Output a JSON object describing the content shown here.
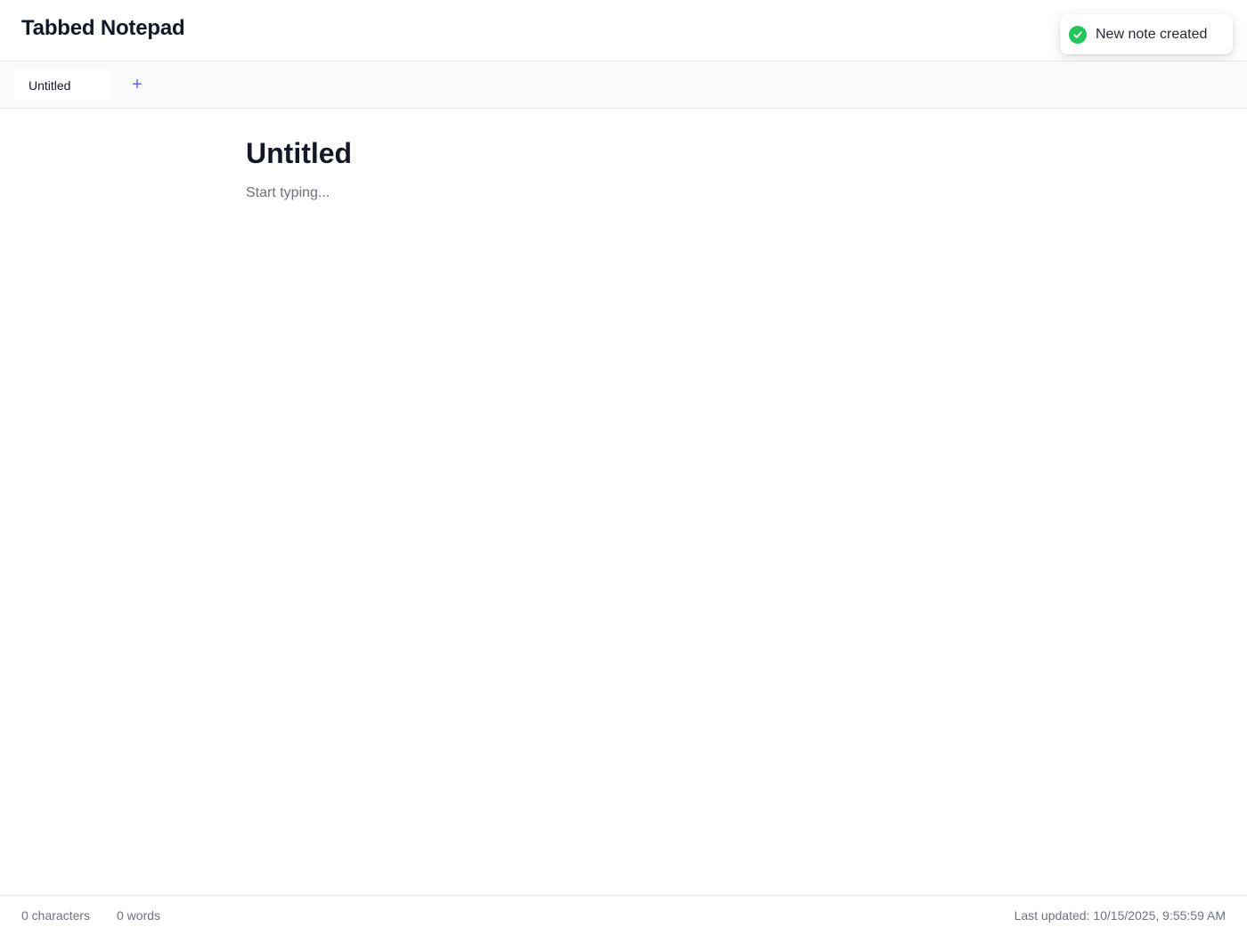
{
  "header": {
    "title": "Tabbed Notepad"
  },
  "toast": {
    "message": "New note created",
    "icon": "check-circle-icon",
    "color": "#22c55e"
  },
  "tabs": [
    {
      "label": "Untitled",
      "active": true
    }
  ],
  "add_tab": {
    "icon": "plus-icon",
    "glyph": "+",
    "color": "#6366f1"
  },
  "editor": {
    "title": "Untitled",
    "body_placeholder": "Start typing...",
    "body_value": ""
  },
  "footer": {
    "characters": "0 characters",
    "words": "0 words",
    "last_updated": "Last updated: 10/15/2025, 9:55:59 AM"
  }
}
